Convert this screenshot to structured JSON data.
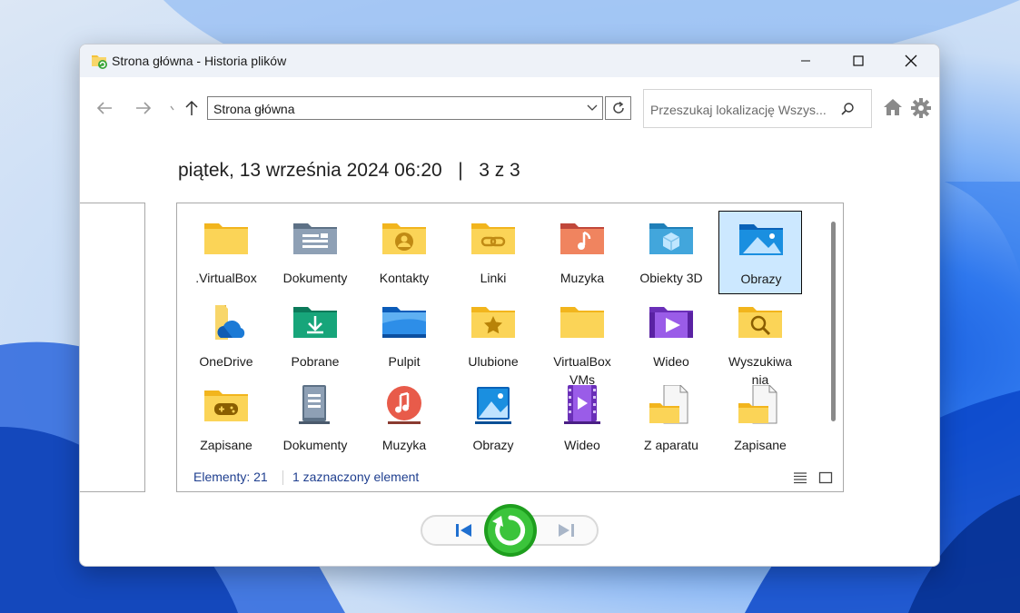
{
  "window": {
    "title": "Strona główna - Historia plików"
  },
  "toolbar": {
    "address": "Strona główna",
    "search_placeholder": "Przeszukaj lokalizację Wszys..."
  },
  "snapshot": {
    "date": "piątek, 13 września 2024 06:20",
    "separator": "|",
    "position": "3 z 3"
  },
  "files": {
    "items": [
      {
        "label": ".VirtualBox",
        "icon": "folder-icon"
      },
      {
        "label": "Dokumenty",
        "icon": "documents-folder-icon"
      },
      {
        "label": "Kontakty",
        "icon": "contacts-folder-icon"
      },
      {
        "label": "Linki",
        "icon": "links-folder-icon"
      },
      {
        "label": "Muzyka",
        "icon": "music-folder-icon"
      },
      {
        "label": "Obiekty 3D",
        "icon": "3d-objects-folder-icon"
      },
      {
        "label": "Obrazy",
        "icon": "pictures-folder-icon",
        "selected": true
      },
      {
        "label": "OneDrive",
        "icon": "onedrive-folder-icon"
      },
      {
        "label": "Pobrane",
        "icon": "downloads-folder-icon"
      },
      {
        "label": "Pulpit",
        "icon": "desktop-folder-icon"
      },
      {
        "label": "Ulubione",
        "icon": "favorites-folder-icon"
      },
      {
        "label": "VirtualBox VMs",
        "icon": "folder-icon"
      },
      {
        "label": "Wideo",
        "icon": "videos-folder-icon"
      },
      {
        "label": "Wyszukiwania",
        "icon": "searches-folder-icon"
      },
      {
        "label": "Zapisane",
        "icon": "saved-games-folder-icon"
      },
      {
        "label": "Dokumenty",
        "icon": "documents-library-icon"
      },
      {
        "label": "Muzyka",
        "icon": "music-library-icon"
      },
      {
        "label": "Obrazy",
        "icon": "pictures-library-icon"
      },
      {
        "label": "Wideo",
        "icon": "videos-library-icon"
      },
      {
        "label": "Z aparatu",
        "icon": "camera-roll-icon"
      },
      {
        "label": "Zapisane",
        "icon": "saved-pictures-icon"
      }
    ]
  },
  "status": {
    "count": "Elementy: 21",
    "selected": "1 zaznaczony element"
  },
  "colors": {
    "accent": "#0067c0",
    "selection": "#cce8ff",
    "restore": "#2fb52f",
    "folder": "#f8c53a"
  }
}
